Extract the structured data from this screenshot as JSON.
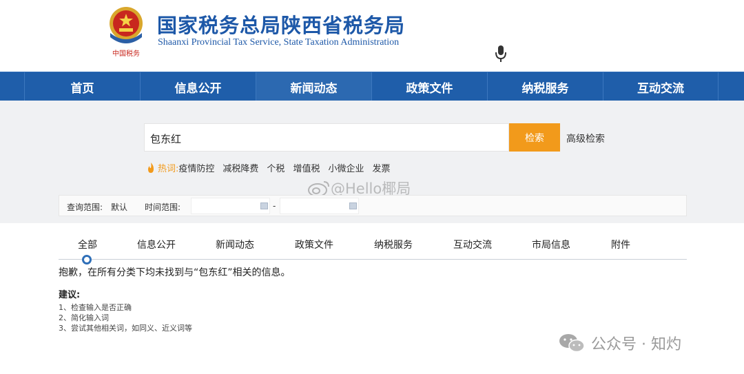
{
  "header": {
    "title_cn": "国家税务总局陕西省税务局",
    "title_en": "Shaanxi Provincial Tax Service, State Taxation Administration",
    "emblem_icon": "tax-emblem-icon",
    "mic_icon": "microphone-icon"
  },
  "nav": {
    "items": [
      "首页",
      "信息公开",
      "新闻动态",
      "政策文件",
      "纳税服务",
      "互动交流"
    ],
    "active_index": 2
  },
  "search": {
    "value": "包东红",
    "button_label": "检索",
    "advanced_label": "高级检索"
  },
  "hot": {
    "label": "热词:",
    "icon": "flame-icon",
    "words": [
      "疫情防控",
      "减税降费",
      "个税",
      "增值税",
      "小微企业",
      "发票"
    ]
  },
  "filter": {
    "range_label": "查询范围:",
    "range_value": "默认",
    "time_label": "时间范围:",
    "separator": "-",
    "calendar_icon": "calendar-icon"
  },
  "tabs": {
    "items": [
      "全部",
      "信息公开",
      "新闻动态",
      "政策文件",
      "纳税服务",
      "互动交流",
      "市局信息",
      "附件"
    ],
    "active_index": 0
  },
  "result": {
    "message": "抱歉，在所有分类下均未找到与“包东红”相关的信息。",
    "suggestion_title": "建议:",
    "suggestions": [
      "1、检查输入是否正确",
      "2、简化输入词",
      "3、尝试其他相关词，如同义、近义词等"
    ]
  },
  "watermarks": {
    "weibo": "@Hello椰局",
    "weibo_icon": "weibo-icon",
    "wechat": "公众号 · 知灼",
    "wechat_icon": "wechat-icon"
  },
  "colors": {
    "brand_blue": "#1f5eaa",
    "accent_orange": "#f29a1b"
  }
}
